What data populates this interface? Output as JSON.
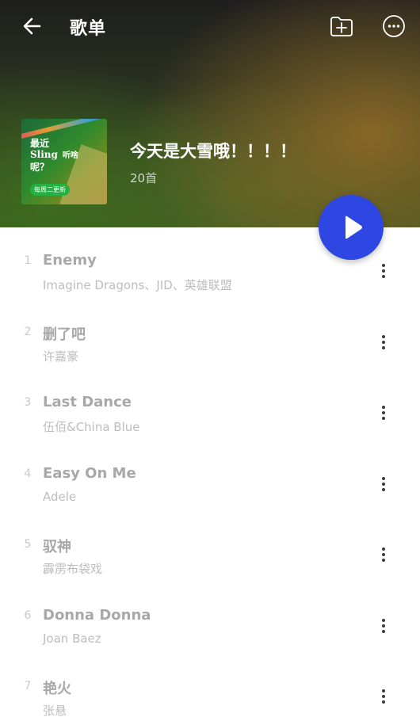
{
  "header": {
    "title": "歌单",
    "back_icon": "arrow-left-icon",
    "add_icon": "folder-plus-icon",
    "more_icon": "more-horizontal-icon"
  },
  "playlist": {
    "name": "今天是大雪哦！！！！",
    "count": "20首",
    "cover": {
      "line1": "最近",
      "line2": "Sling",
      "line2_small": "听啥",
      "line3": "呢？",
      "badge": "每周二更新"
    },
    "play_icon": "play-icon",
    "accent": "#2e47e3"
  },
  "songs": [
    {
      "index": "1",
      "title": "Enemy",
      "artist": "Imagine Dragons、JID、英雄联盟"
    },
    {
      "index": "2",
      "title": "删了吧",
      "artist": "许嘉豪"
    },
    {
      "index": "3",
      "title": "Last Dance",
      "artist": "伍佰&China Blue"
    },
    {
      "index": "4",
      "title": "Easy On Me",
      "artist": "Adele"
    },
    {
      "index": "5",
      "title": "驭神",
      "artist": "霹雳布袋戏"
    },
    {
      "index": "6",
      "title": "Donna Donna",
      "artist": "Joan Baez"
    },
    {
      "index": "7",
      "title": "艳火",
      "artist": "张悬"
    }
  ]
}
